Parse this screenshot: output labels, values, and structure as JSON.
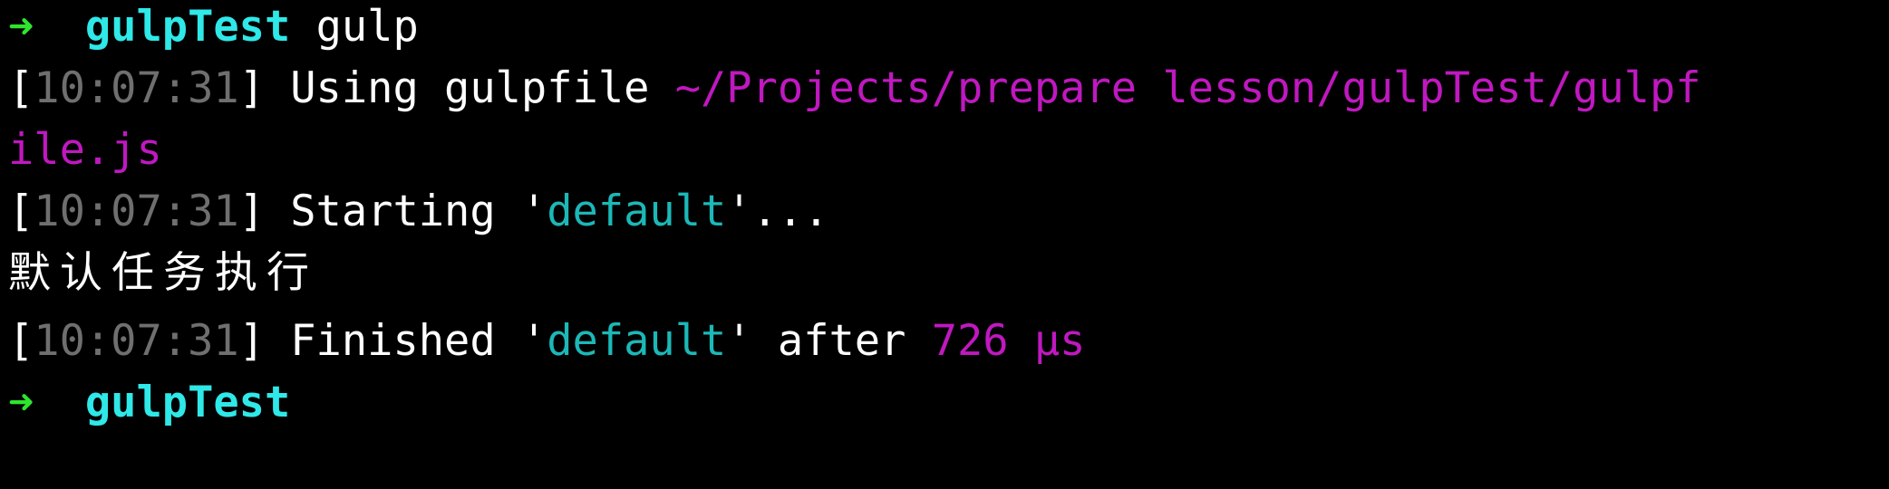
{
  "prompt": {
    "arrow": "➜",
    "directory": "gulpTest",
    "command": "gulp"
  },
  "log": {
    "timestamp": "10:07:31",
    "using_gulpfile_text": "Using gulpfile",
    "gulpfile_path_line1": "~/Projects/prepare lesson/gulpTest/gulpf",
    "gulpfile_path_line2": "ile.js",
    "starting_text": "Starting '",
    "task_name": "default",
    "starting_suffix": "'...",
    "task_output": "默认任务执行",
    "finished_text": "Finished '",
    "after_text": "' after",
    "duration": "726 μs"
  },
  "prompt_after": {
    "arrow": "➜",
    "directory": "gulpTest"
  },
  "colors": {
    "background": "#000000",
    "arrow": "#2ee52e",
    "directory": "#2fe8e8",
    "timestamp": "#6f6f6f",
    "path": "#c018c0",
    "task_name": "#1cb8b8",
    "duration": "#c018c0",
    "text": "#ffffff"
  }
}
